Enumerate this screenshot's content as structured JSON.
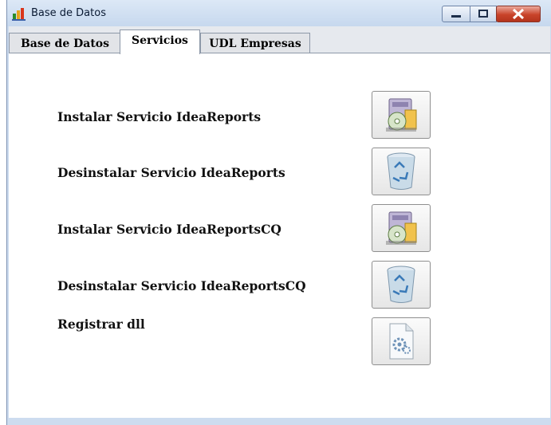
{
  "window": {
    "title": "Base de Datos",
    "controls": [
      "minimize",
      "maximize",
      "close"
    ]
  },
  "tabs": [
    {
      "label": "Base de Datos",
      "active": false
    },
    {
      "label": "Servicios",
      "active": true
    },
    {
      "label": "UDL Empresas",
      "active": false
    }
  ],
  "services": [
    {
      "label": "Instalar Servicio IdeaReports",
      "icon": "install-icon"
    },
    {
      "label": "Desinstalar Servicio IdeaReports",
      "icon": "recycle-bin-icon"
    },
    {
      "label": "Instalar Servicio IdeaReportsCQ",
      "icon": "install-icon"
    },
    {
      "label": "Desinstalar Servicio IdeaReportsCQ",
      "icon": "recycle-bin-icon"
    },
    {
      "label": "Registrar dll",
      "icon": "dll-gear-icon"
    }
  ],
  "colors": {
    "frame": "#cddcef",
    "close_button": "#c9432a",
    "panel": "#ffffff"
  }
}
